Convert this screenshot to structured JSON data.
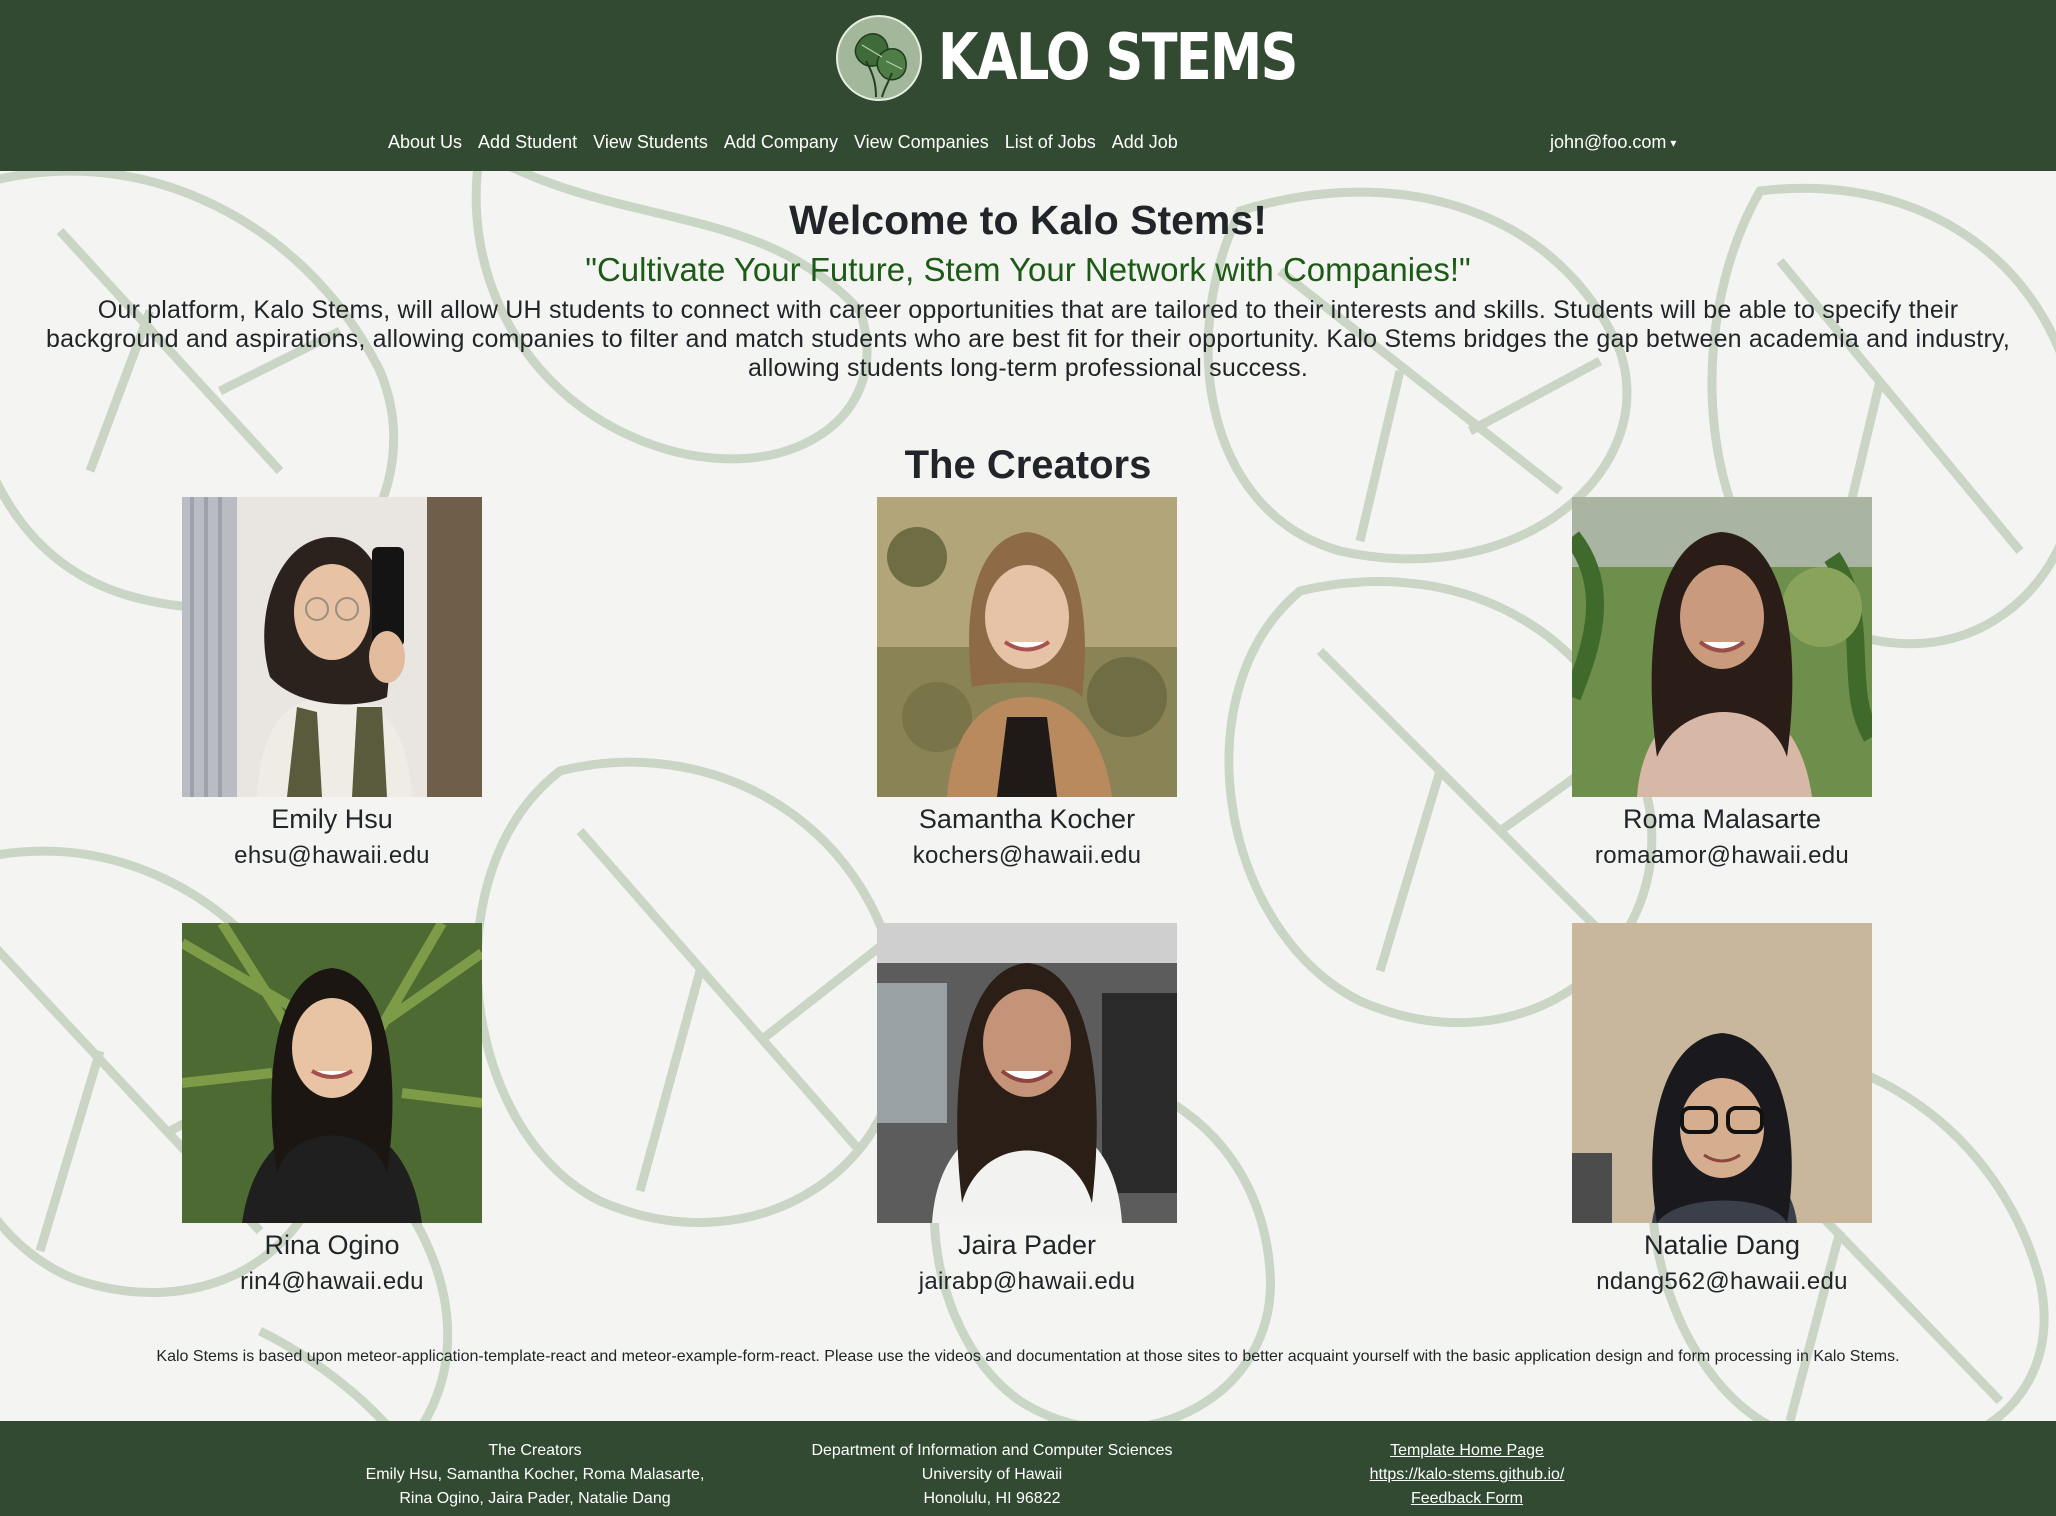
{
  "brand": {
    "name": "KALO STEMS",
    "logo_icon": "taro-leaf-logo-icon"
  },
  "nav": {
    "links": [
      "About Us",
      "Add Student",
      "View Students",
      "Add Company",
      "View Companies",
      "List of Jobs",
      "Add Job"
    ],
    "user": "john@foo.com"
  },
  "main": {
    "title": "Welcome to Kalo Stems!",
    "tagline": "\"Cultivate Your Future, Stem Your Network with Companies!\"",
    "intro": [
      "Our platform, Kalo Stems, will allow UH students to connect with career opportunities that are tailored to their interests and skills. Students will be able to specify their",
      "background and aspirations, allowing companies to filter and match students who are best fit for their opportunity. Kalo Stems bridges the gap between academia and industry,",
      "allowing students long-term professional success."
    ],
    "creators_title": "The Creators",
    "creators": [
      {
        "name": "Emily Hsu",
        "email": "ehsu@hawaii.edu"
      },
      {
        "name": "Samantha Kocher",
        "email": "kochers@hawaii.edu"
      },
      {
        "name": "Roma Malasarte",
        "email": "romaamor@hawaii.edu"
      },
      {
        "name": "Rina Ogino",
        "email": "rin4@hawaii.edu"
      },
      {
        "name": "Jaira Pader",
        "email": "jairabp@hawaii.edu"
      },
      {
        "name": "Natalie Dang",
        "email": "ndang562@hawaii.edu"
      }
    ],
    "note": "Kalo Stems is based upon meteor-application-template-react and meteor-example-form-react. Please use the videos and documentation at those sites to better acquaint yourself with the basic application design and form processing in Kalo Stems."
  },
  "footer": {
    "col1": [
      "The Creators",
      "Emily Hsu, Samantha Kocher, Roma Malasarte,",
      "Rina Ogino, Jaira Pader, Natalie Dang"
    ],
    "col2": [
      "Department of Information and Computer Sciences",
      "University of Hawaii",
      "Honolulu, HI 96822"
    ],
    "links": [
      "Template Home Page",
      "https://kalo-stems.github.io/",
      "Feedback Form"
    ]
  },
  "colors": {
    "nav_bg": "#324932",
    "tagline": "#1c5a16",
    "leaf_stroke": "#a9baa3"
  }
}
